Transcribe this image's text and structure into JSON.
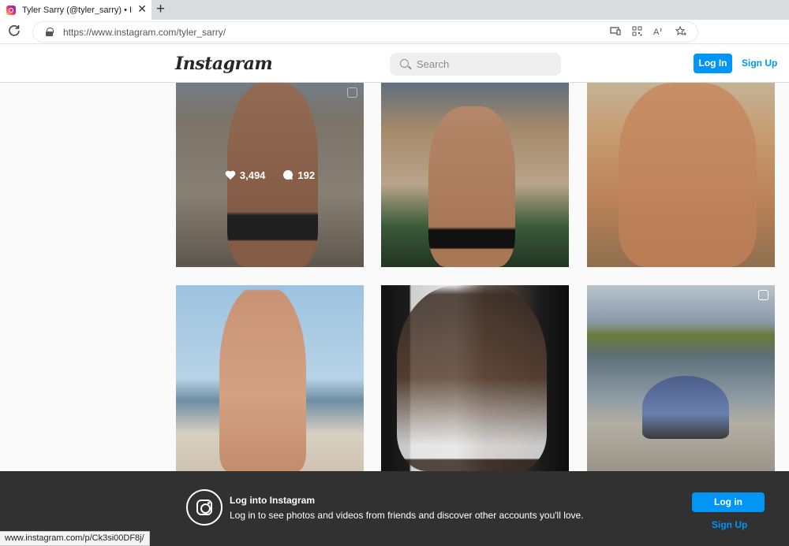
{
  "browser": {
    "tab_title": "Tyler Sarry (@tyler_sarry) • Instagram",
    "tab_close": "✕",
    "new_tab": "+",
    "url": "https://www.instagram.com/tyler_sarry/",
    "status_url": "www.instagram.com/p/Ck3si00DF8j/",
    "icons": [
      "reload-icon",
      "lock-icon",
      "app-available-icon",
      "qr-code-icon",
      "read-aloud-icon",
      "favorite-icon"
    ]
  },
  "ig_header": {
    "logo": "Instagram",
    "search_placeholder": "Search",
    "login_label": "Log In",
    "signup_label": "Sign Up"
  },
  "grid": {
    "hovered_post": {
      "likes": "3,494",
      "comments": "192"
    }
  },
  "banner": {
    "title": "Log into Instagram",
    "text": "Log in to see photos and videos from friends and discover other accounts you'll love.",
    "login_label": "Log in",
    "signup_label": "Sign Up"
  },
  "colors": {
    "accent": "#0095f6",
    "banner_bg": "#262626"
  }
}
